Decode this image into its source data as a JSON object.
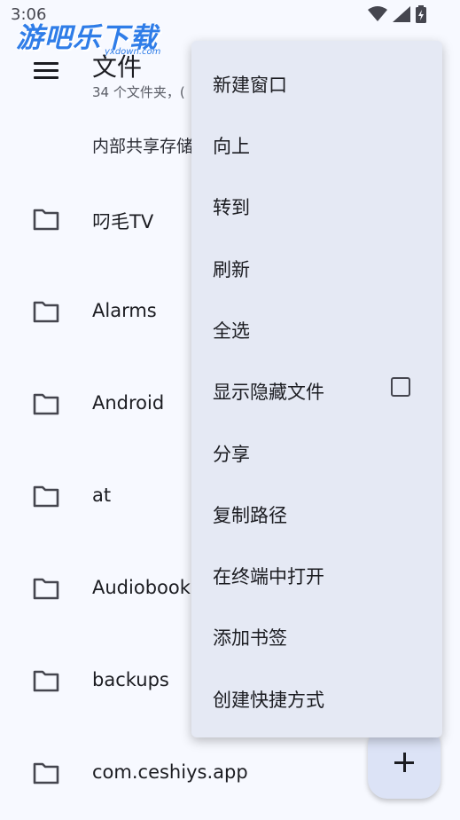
{
  "status": {
    "time": "3:06"
  },
  "watermark": {
    "text": "游吧乐下载",
    "sub": "yxdown.com"
  },
  "appbar": {
    "title": "文件",
    "subtitle": "34 个文件夹，("
  },
  "breadcrumb": "内部共享存储",
  "files": [
    {
      "name": "叼毛TV",
      "icon": "folder-icon"
    },
    {
      "name": "Alarms",
      "icon": "folder-icon"
    },
    {
      "name": "Android",
      "icon": "folder-icon"
    },
    {
      "name": "at",
      "icon": "folder-icon"
    },
    {
      "name": "Audiobooks",
      "icon": "folder-icon"
    },
    {
      "name": "backups",
      "icon": "folder-icon"
    },
    {
      "name": "com.ceshiys.app",
      "icon": "folder-icon"
    }
  ],
  "menu": {
    "items": [
      {
        "label": "新建窗口"
      },
      {
        "label": "向上"
      },
      {
        "label": "转到"
      },
      {
        "label": "刷新"
      },
      {
        "label": "全选"
      },
      {
        "label": "显示隐藏文件",
        "checkbox": true,
        "checked": false
      },
      {
        "label": "分享"
      },
      {
        "label": "复制路径"
      },
      {
        "label": "在终端中打开"
      },
      {
        "label": "添加书签"
      },
      {
        "label": "创建快捷方式"
      }
    ]
  },
  "fab": {
    "icon": "plus-icon"
  },
  "colors": {
    "background": "#f7f9ff",
    "menu_background": "#e5e9f4",
    "fab_background": "#dce3f6",
    "watermark": "#2f7de8"
  }
}
